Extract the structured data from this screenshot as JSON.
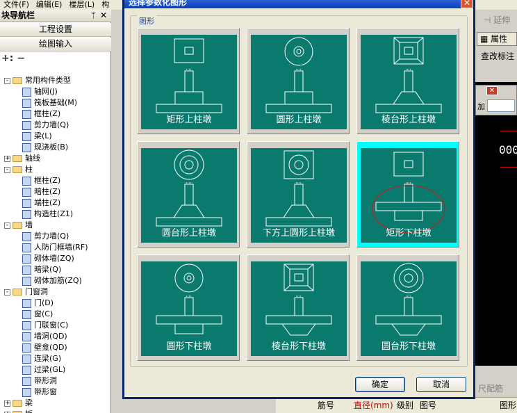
{
  "host": {
    "menu": [
      "文件(F)",
      "编辑(E)",
      "楼层(L)",
      "构"
    ],
    "left_panel_title": "块导航栏",
    "project_settings": "工程设置",
    "drawing_input": "绘图输入",
    "right_labels": {
      "extend": "延伸",
      "properties": "属性",
      "check_annotation": "查改标注",
      "fit_rebar": "尺配筋",
      "num_000": "000",
      "add_label": "加"
    },
    "bottom_cols": [
      "筋号",
      "直径(mm)",
      "级别",
      "图号",
      "图形"
    ]
  },
  "tree": [
    {
      "label": "常用构件类型",
      "level": 0,
      "exp": "-",
      "type": "folder"
    },
    {
      "label": "轴网(J)",
      "level": 1,
      "type": "item"
    },
    {
      "label": "筏板基础(M)",
      "level": 1,
      "type": "item"
    },
    {
      "label": "框柱(Z)",
      "level": 1,
      "type": "item"
    },
    {
      "label": "剪力墙(Q)",
      "level": 1,
      "type": "item"
    },
    {
      "label": "梁(L)",
      "level": 1,
      "type": "item"
    },
    {
      "label": "现浇板(B)",
      "level": 1,
      "type": "item"
    },
    {
      "label": "轴线",
      "level": 0,
      "exp": "+",
      "type": "folder"
    },
    {
      "label": "柱",
      "level": 0,
      "exp": "-",
      "type": "folder"
    },
    {
      "label": "框柱(Z)",
      "level": 1,
      "type": "item"
    },
    {
      "label": "暗柱(Z)",
      "level": 1,
      "type": "item"
    },
    {
      "label": "端柱(Z)",
      "level": 1,
      "type": "item"
    },
    {
      "label": "构造柱(Z1)",
      "level": 1,
      "type": "item"
    },
    {
      "label": "墙",
      "level": 0,
      "exp": "-",
      "type": "folder"
    },
    {
      "label": "剪力墙(Q)",
      "level": 1,
      "type": "item"
    },
    {
      "label": "人防门框墙(RF)",
      "level": 1,
      "type": "item"
    },
    {
      "label": "砌体墙(ZQ)",
      "level": 1,
      "type": "item"
    },
    {
      "label": "暗梁(Q)",
      "level": 1,
      "type": "item"
    },
    {
      "label": "砌体加筋(ZQ)",
      "level": 1,
      "type": "item"
    },
    {
      "label": "门窗洞",
      "level": 0,
      "exp": "-",
      "type": "folder"
    },
    {
      "label": "门(D)",
      "level": 1,
      "type": "item"
    },
    {
      "label": "窗(C)",
      "level": 1,
      "type": "item"
    },
    {
      "label": "门联窗(C)",
      "level": 1,
      "type": "item"
    },
    {
      "label": "墙洞(QD)",
      "level": 1,
      "type": "item"
    },
    {
      "label": "壁龛(QD)",
      "level": 1,
      "type": "item"
    },
    {
      "label": "连梁(G)",
      "level": 1,
      "type": "item"
    },
    {
      "label": "过梁(GL)",
      "level": 1,
      "type": "item"
    },
    {
      "label": "带形洞",
      "level": 1,
      "type": "item"
    },
    {
      "label": "带形窗",
      "level": 1,
      "type": "item"
    },
    {
      "label": "梁",
      "level": 0,
      "exp": "+",
      "type": "folder"
    },
    {
      "label": "板",
      "level": 0,
      "exp": "+",
      "type": "folder"
    }
  ],
  "dialog": {
    "title": "选择参数化图形",
    "close_icon": "close-icon",
    "group_label": "图形",
    "shapes": [
      {
        "label": "矩形上柱墩",
        "top": "square",
        "base": "rect-up",
        "selected": false
      },
      {
        "label": "圆形上柱墩",
        "top": "circle",
        "base": "rect-up",
        "selected": false
      },
      {
        "label": "棱台形上柱墩",
        "top": "frustum",
        "base": "trap-up",
        "selected": false
      },
      {
        "label": "圆台形上柱墩",
        "top": "cone",
        "base": "trap-up",
        "selected": false
      },
      {
        "label": "下方上圆形上柱墩",
        "top": "square-circle",
        "base": "trap-up",
        "selected": false
      },
      {
        "label": "矩形下柱墩",
        "top": "square",
        "base": "rect-down",
        "selected": true
      },
      {
        "label": "圆形下柱墩",
        "top": "circle",
        "base": "rect-down",
        "selected": false
      },
      {
        "label": "棱台形下柱墩",
        "top": "frustum",
        "base": "trap-down",
        "selected": false
      },
      {
        "label": "圆台形下柱墩",
        "top": "cone",
        "base": "trap-down",
        "selected": false
      }
    ],
    "ok_label": "确定",
    "cancel_label": "取消"
  },
  "colors": {
    "tile_bg": "#0a7a6e",
    "selected_border": "#00ffff",
    "annotation_circle": "#b0282a",
    "title_bar": "#0a3fb8"
  }
}
